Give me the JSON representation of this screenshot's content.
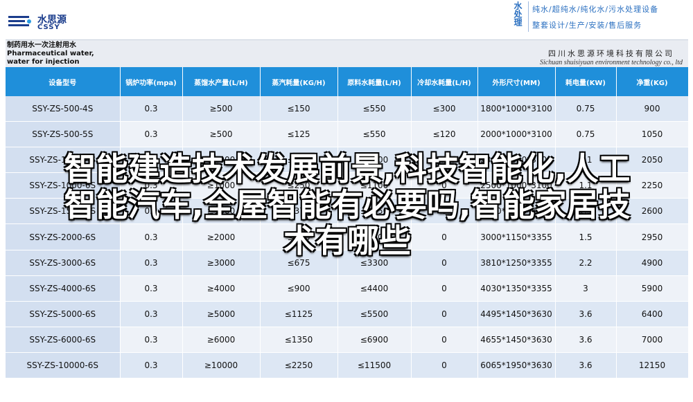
{
  "brand": {
    "name": "水思源",
    "sub": "CSSY",
    "mark_color": "#1a3c8c"
  },
  "slogan": {
    "vertical": "水处理",
    "line1": "纯水/超纯水/纯化水/污水处理设备",
    "line2": "整套设计/生产/安装/售后服务"
  },
  "doc": {
    "title_line1": "制药用水一次注射用水",
    "title_line2": "Pharmaceutical water, water for injection",
    "company_cn": "四川水思源环境科技有限公司",
    "company_en": "Sichuan shuisiyuan environment technology co., ltd"
  },
  "table": {
    "headers": [
      "设备型号",
      "锅炉功率(mpa)",
      "蒸馏水产量(L/H)",
      "蒸汽耗量(KG/H)",
      "原料水耗量(L/H)",
      "冷却水耗量(L/H)",
      "外形尺寸(MM)",
      "耗电量(KW)",
      "净重(KG)"
    ],
    "rows": [
      [
        "SSY-ZS-500-4S",
        "0.3",
        "≥500",
        "≤150",
        "≤550",
        "≤300",
        "1800*1000*3100",
        "0.75",
        "900"
      ],
      [
        "SSY-ZS-500-5S",
        "0.3",
        "≥500",
        "≤125",
        "≤550",
        "≤120",
        "2000*1000*3100",
        "0.75",
        "1050"
      ],
      [
        "SSY-ZS-1000-4S",
        "0.3",
        "≥1000",
        "≤300",
        "≤1100",
        "≤600",
        "2300*1000*3100",
        "1.1",
        "2050"
      ],
      [
        "SSY-ZS-1000-6S",
        "0.3",
        "≥1000",
        "≤250",
        "≤1100",
        "0",
        "2500*1000*3100",
        "1.1",
        "2250"
      ],
      [
        "SSY-ZS-1500-6S",
        "0.3",
        "≥1500",
        "≤375",
        "≤1650",
        "0",
        "2800*1100*3355",
        "1.5",
        "2600"
      ],
      [
        "SSY-ZS-2000-6S",
        "0.3",
        "≥2000",
        "≤500",
        "≤2200",
        "0",
        "3000*1150*3355",
        "1.5",
        "2950"
      ],
      [
        "SSY-ZS-3000-6S",
        "0.3",
        "≥3000",
        "≤675",
        "≤3300",
        "0",
        "3810*1250*3355",
        "2.2",
        "4900"
      ],
      [
        "SSY-ZS-4000-6S",
        "0.3",
        "≥4000",
        "≤900",
        "≤4400",
        "0",
        "4030*1350*3355",
        "3",
        "5900"
      ],
      [
        "SSY-ZS-5000-6S",
        "0.3",
        "≥5000",
        "≤1125",
        "≤5500",
        "0",
        "4495*1450*3630",
        "3.6",
        "6400"
      ],
      [
        "SSY-ZS-6000-6S",
        "0.3",
        "≥6000",
        "≤1350",
        "≤6900",
        "0",
        "4655*1450*3630",
        "3.6",
        "7000"
      ],
      [
        "SSY-ZS-10000-6S",
        "0.3",
        "≥10000",
        "≤2250",
        "≤11500",
        "0",
        "6065*1950*3630",
        "3.6",
        "12150"
      ]
    ]
  },
  "overlay": {
    "line1": "智能建造技术发展前景,科技智能化,人工",
    "line2": "智能汽车,全屋智能有必要吗,智能家居技",
    "line3": "术有哪些"
  }
}
